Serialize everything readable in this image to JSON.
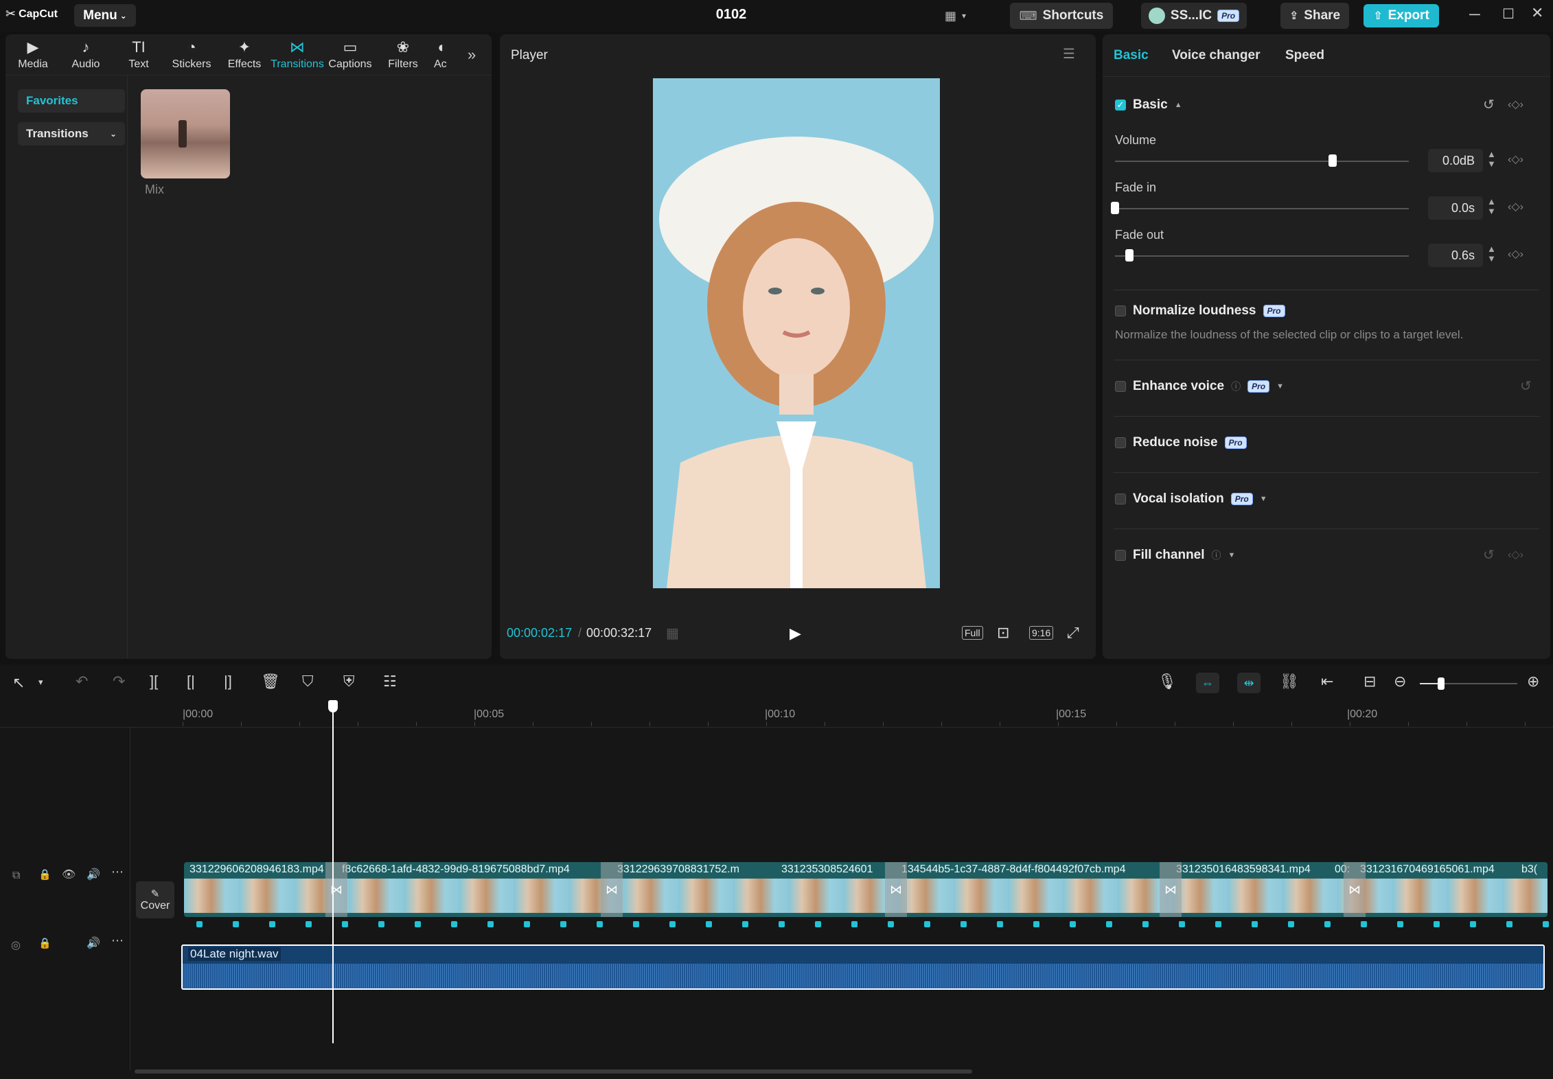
{
  "app": {
    "logo_text": "CapCut",
    "menu_label": "Menu",
    "project_title": "0102"
  },
  "titlebar": {
    "shortcuts_label": "Shortcuts",
    "user_label": "SS...IC",
    "pro_label": "Pro",
    "share_label": "Share",
    "export_label": "Export"
  },
  "toolbar": {
    "items": [
      {
        "label": "Media",
        "icon": "media-icon"
      },
      {
        "label": "Audio",
        "icon": "audio-icon"
      },
      {
        "label": "Text",
        "icon": "text-icon"
      },
      {
        "label": "Stickers",
        "icon": "stickers-icon"
      },
      {
        "label": "Effects",
        "icon": "effects-icon"
      },
      {
        "label": "Transitions",
        "icon": "transitions-icon"
      },
      {
        "label": "Captions",
        "icon": "captions-icon"
      },
      {
        "label": "Filters",
        "icon": "filters-icon"
      },
      {
        "label": "Aс",
        "icon": "adjust-icon"
      }
    ],
    "active_index": 5
  },
  "library": {
    "side_items": [
      "Favorites",
      "Transitions"
    ],
    "tile_label": "Mix"
  },
  "player": {
    "title": "Player",
    "current_time": "00:00:02:17",
    "total_time": "00:00:32:17",
    "full_label": "Full",
    "ratio_label": "9:16"
  },
  "inspector": {
    "tabs": [
      "Basic",
      "Voice changer",
      "Speed"
    ],
    "basic_label": "Basic",
    "volume": {
      "label": "Volume",
      "value": "0.0dB",
      "level": 0.74
    },
    "fade_in": {
      "label": "Fade in",
      "value": "0.0s",
      "level": 0.0
    },
    "fade_out": {
      "label": "Fade out",
      "value": "0.6s",
      "level": 0.05
    },
    "normalize": {
      "label": "Normalize loudness",
      "desc": "Normalize the loudness of the selected clip or clips to a target level."
    },
    "enhance_label": "Enhance voice",
    "reduce_label": "Reduce noise",
    "vocal_label": "Vocal isolation",
    "fill_label": "Fill channel",
    "pro_label": "Pro"
  },
  "timeline": {
    "ruler": [
      "|00:00",
      "|00:05",
      "|00:10",
      "|00:15",
      "|00:20"
    ],
    "cover_label": "Cover",
    "clips": [
      "331229606208946183.mp4",
      "f8c62668-1afd-4832-99d9-819675088bd7.mp4",
      "331229639708831752.m",
      "331235308524601",
      "134544b5-1c37-4887-8d4f-f804492f07cb.mp4",
      "331235016483598341.mp4",
      "00:",
      "331231670469165061.mp4",
      "b3("
    ],
    "audio_clip": "04Late night.wav"
  },
  "colors": {
    "accent": "#22c3d6",
    "clip_bar": "#1e5e62",
    "audio_bg": "#15416e"
  }
}
